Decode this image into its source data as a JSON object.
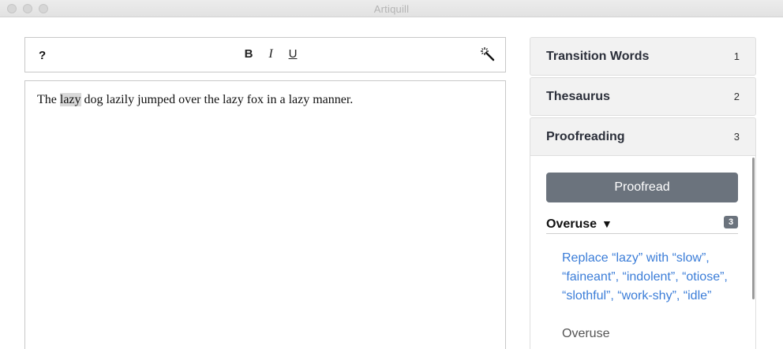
{
  "window": {
    "title": "Artiquill"
  },
  "toolbar": {
    "help_label": "?",
    "bold_label": "B",
    "italic_label": "I",
    "underline_label": "U",
    "wand_icon": "magic-wand-icon"
  },
  "editor": {
    "text_before": "The ",
    "highlighted_word": "lazy",
    "text_after": " dog lazily jumped over the lazy fox in a lazy manner."
  },
  "sidebar": {
    "panels": [
      {
        "title": "Transition Words",
        "number": "1"
      },
      {
        "title": "Thesaurus",
        "number": "2"
      },
      {
        "title": "Proofreading",
        "number": "3"
      }
    ],
    "proofreading": {
      "button_label": "Proofread",
      "section_title": "Overuse",
      "section_caret": "▼",
      "count": "3",
      "suggestion_text": "Replace “lazy” with “slow”, “faineant”, “indolent”, “otiose”, “slothful”, “work-shy”, “idle”",
      "suggestion_category": "Overuse"
    }
  },
  "colors": {
    "accent_link": "#3b7dd8",
    "button_bg": "#6b737d",
    "highlight": "#d9d9d9"
  }
}
